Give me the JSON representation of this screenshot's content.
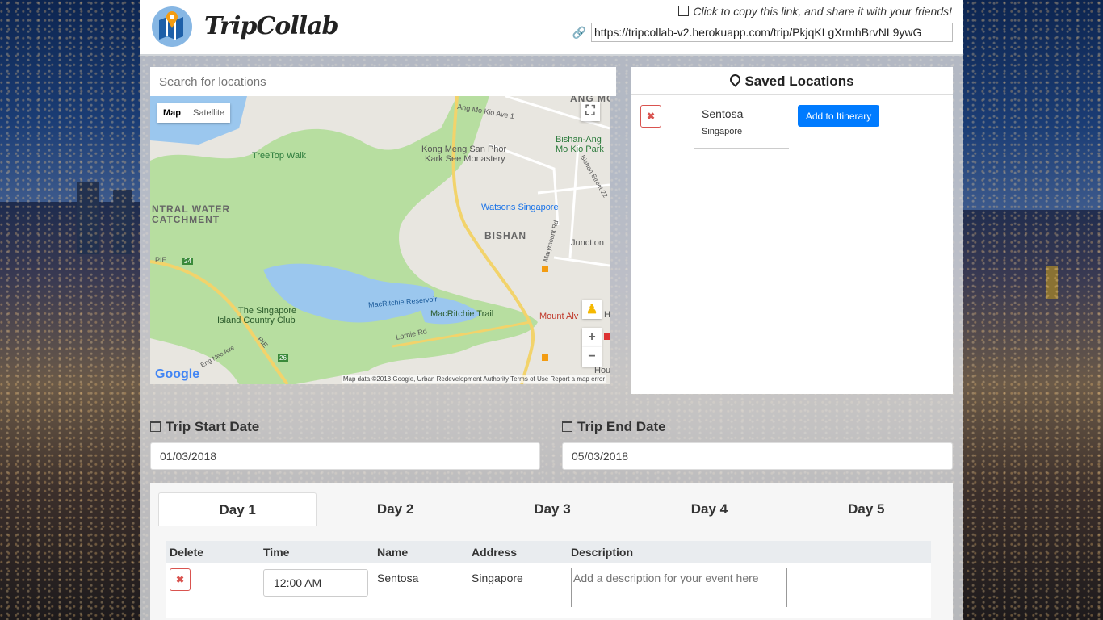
{
  "header": {
    "app_name": "TripCollab",
    "copy_hint": "Click to copy this link, and share it with your friends!",
    "share_link": "https://tripcollab-v2.herokuapp.com/trip/PkjqKLgXrmhBrvNL9ywG"
  },
  "map": {
    "search_placeholder": "Search for locations",
    "toggle_map": "Map",
    "toggle_satellite": "Satellite",
    "labels": {
      "ang_mo": "ANG MO",
      "ang_mo_kio_ave_1": "Ang Mo Kio Ave 1",
      "treetop": "TreeTop Walk",
      "kong_meng_1": "Kong Meng San Phor",
      "kong_meng_2": "Kark See Monastery",
      "bishan_amk_1": "Bishan-Ang",
      "bishan_amk_2": "Mo Kio Park",
      "bishan_st": "Bishan Street 22",
      "central_water_1": "NTRAL WATER",
      "central_water_2": "CATCHMENT",
      "watsons": "Watsons Singapore",
      "bishan": "BISHAN",
      "marymount": "Marymount Rd",
      "junction": "Junction",
      "pie": "PIE",
      "pie_num": "24",
      "macritchie_res": "MacRitchie Reservoir",
      "island_club_1": "The Singapore",
      "island_club_2": "Island Country Club",
      "macritchie_trail": "MacRitchie Trail",
      "mount_alvernia": "Mount Alv",
      "lornie": "Lornie Rd",
      "pie_lower": "PIE",
      "road_26": "26",
      "eng_neo": "Eng Neo Ave",
      "hou": "Hou",
      "h": "H"
    },
    "google": "Google",
    "attribution": "Map data ©2018 Google, Urban Redevelopment Authority   Terms of Use   Report a map error"
  },
  "saved": {
    "title": "Saved Locations",
    "items": [
      {
        "name": "Sentosa",
        "sub": "Singapore",
        "add_label": "Add to Itinerary"
      }
    ]
  },
  "dates": {
    "start_label": "Trip Start Date",
    "start_value": "01/03/2018",
    "end_label": "Trip End Date",
    "end_value": "05/03/2018"
  },
  "days": {
    "tabs": [
      "Day 1",
      "Day 2",
      "Day 3",
      "Day 4",
      "Day 5"
    ],
    "columns": [
      "Delete",
      "Time",
      "Name",
      "Address",
      "Description"
    ],
    "rows": [
      {
        "time": "12:00 AM",
        "name": "Sentosa",
        "address": "Singapore",
        "description_placeholder": "Add a description for your event here"
      }
    ]
  },
  "colors": {
    "accent": "#007bff",
    "danger": "#d9534f",
    "map_green": "#b7dea0",
    "map_water": "#9bc7ee"
  }
}
